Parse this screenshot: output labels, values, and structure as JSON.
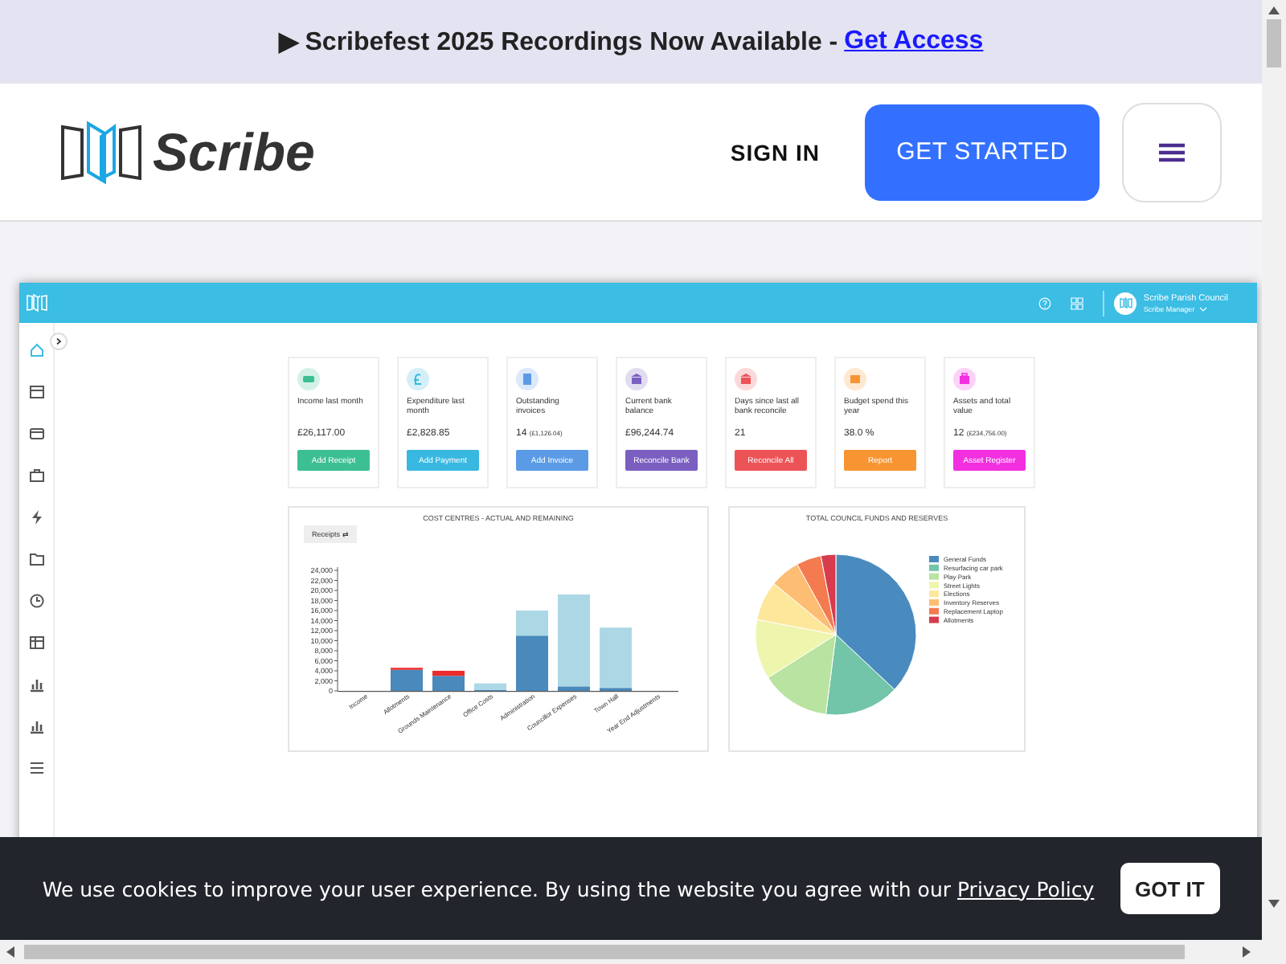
{
  "announcement": {
    "marker": "▶",
    "text": "Scribefest 2025 Recordings Now Available - ",
    "link": "Get Access"
  },
  "header": {
    "logo_text": "Scribe",
    "sign_in": "SIGN IN",
    "get_started": "GET STARTED"
  },
  "app": {
    "account": {
      "name": "Scribe Parish Council",
      "role": "Scribe Manager"
    },
    "cards": [
      {
        "label": "Income last month",
        "value": "£26,117.00",
        "button": "Add Receipt",
        "color": "#3dbf94"
      },
      {
        "label": "Expenditure last month",
        "value": "£2,828.85",
        "button": "Add Payment",
        "color": "#38b8e0"
      },
      {
        "label": "Outstanding invoices",
        "value": "14",
        "sub": "(£1,126.04)",
        "button": "Add Invoice",
        "color": "#5b9be6"
      },
      {
        "label": "Current bank balance",
        "value": "£96,244.74",
        "button": "Reconcile Bank",
        "color": "#7a5fc0"
      },
      {
        "label": "Days since last all bank reconcile",
        "value": "21",
        "button": "Reconcile All",
        "color": "#ec5357"
      },
      {
        "label": "Budget spend this year",
        "value": "38.0 %",
        "button": "Report",
        "color": "#f79533"
      },
      {
        "label": "Assets and total value",
        "value": "12",
        "sub": "(£234,756.00)",
        "button": "Asset Register",
        "color": "#f230e0"
      }
    ],
    "bar_panel": {
      "title": "COST CENTRES - ACTUAL AND REMAINING",
      "toggle": "Receipts ⇄",
      "chart_data": {
        "type": "bar",
        "stacked": true,
        "categories": [
          "Income",
          "Allotments",
          "Grounds Maintenance",
          "Office Costs",
          "Administration",
          "Councillor Expenses",
          "Town Hall",
          "Year End Adjustments"
        ],
        "ylim": [
          0,
          24000
        ],
        "yticks": [
          {
            "value": 0,
            "label": "0"
          },
          {
            "value": 2000,
            "label": "2,000"
          },
          {
            "value": 4000,
            "label": "4,000"
          },
          {
            "value": 6000,
            "label": "6,000"
          },
          {
            "value": 8000,
            "label": "8,000"
          },
          {
            "value": 10000,
            "label": "10,000"
          },
          {
            "value": 12000,
            "label": "12,000"
          },
          {
            "value": 14000,
            "label": "14,000"
          },
          {
            "value": 16000,
            "label": "16,000"
          },
          {
            "value": 18000,
            "label": "18,000"
          },
          {
            "value": 20000,
            "label": "20,000"
          },
          {
            "value": 22000,
            "label": "22,000"
          },
          {
            "value": 24000,
            "label": "24,000"
          }
        ],
        "series": [
          {
            "color": "#4a89bb",
            "values": [
              0,
              4200,
              3000,
              200,
              11000,
              900,
              600,
              0
            ]
          },
          {
            "color": "#ee2b2b",
            "values": [
              0,
              400,
              1000,
              0,
              0,
              0,
              0,
              0
            ]
          },
          {
            "color": "#acd8e6",
            "values": [
              0,
              0,
              0,
              1300,
              5000,
              18300,
              12000,
              0
            ]
          }
        ]
      }
    },
    "pie_panel": {
      "title": "TOTAL COUNCIL FUNDS AND RESERVES",
      "legend": [
        {
          "label": "General Funds",
          "color": "#4a8bbf"
        },
        {
          "label": "Resurfacing car park",
          "color": "#72c5a8"
        },
        {
          "label": "Play Park",
          "color": "#b9e3a0"
        },
        {
          "label": "Street Lights",
          "color": "#eef5ad"
        },
        {
          "label": "Elections",
          "color": "#fde79b"
        },
        {
          "label": "Inventory Reserves",
          "color": "#fdbd72"
        },
        {
          "label": "Replacement Laptop",
          "color": "#f47a4f"
        },
        {
          "label": "Allotments",
          "color": "#d63c4d"
        }
      ]
    }
  },
  "cookie": {
    "text": "We use cookies to improve your user experience. By using the website you agree with our ",
    "link": "Privacy Policy",
    "button": "GOT IT"
  }
}
